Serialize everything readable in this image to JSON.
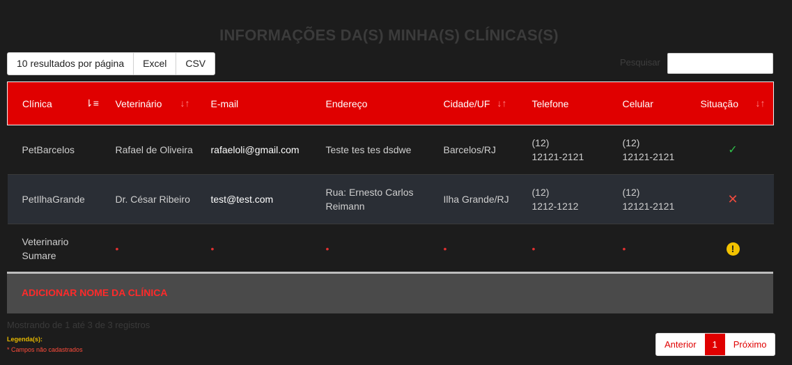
{
  "page": {
    "title": "INFORMAÇÕES DA(S) MINHA(S) CLÍNICAS(S)"
  },
  "toolbar": {
    "page_size_label": "10 resultados por página",
    "excel_label": "Excel",
    "csv_label": "CSV"
  },
  "search": {
    "label": "Pesquisar",
    "value": "",
    "placeholder": ""
  },
  "table": {
    "headers": [
      "Clínica",
      "Veterinário",
      "E-mail",
      "Endereço",
      "Cidade/UF",
      "Telefone",
      "Celular",
      "Situação"
    ],
    "rows": [
      {
        "clinica": "PetBarcelos",
        "veterinario": "Rafael de Oliveira",
        "email": "rafaeloli@gmail.com",
        "endereco": "Teste tes tes dsdwe",
        "cidade": "Barcelos/RJ",
        "telefone_ddd": "(12)",
        "telefone_num": "12121-2121",
        "celular_ddd": "(12)",
        "celular_num": "12121-2121",
        "situacao": "ativo",
        "situacao_icon": "check-icon"
      },
      {
        "clinica": "PetIlhaGrande",
        "veterinario": "Dr. César Ribeiro",
        "email": "test@test.com",
        "endereco": "Rua: Ernesto Carlos Reimann",
        "cidade": "Ilha Grande/RJ",
        "telefone_ddd": "(12)",
        "telefone_num": "1212-1212",
        "celular_ddd": "(12)",
        "celular_num": "12121-2121",
        "situacao": "inativo",
        "situacao_icon": "x-icon"
      },
      {
        "clinica": "Veterinario Sumare",
        "veterinario": "•",
        "email": "•",
        "endereco": "•",
        "cidade": "•",
        "telefone": "•",
        "celular": "•",
        "situacao": "pendente",
        "situacao_icon": "warning-icon"
      }
    ]
  },
  "add_clinic": {
    "label": "ADICIONAR NOME DA CLÍNICA"
  },
  "footer": {
    "info": "Mostrando de 1 até 3 de 3 registros",
    "legend_title": "Legenda(s):",
    "legend_item": "* Campos não cadastrados"
  },
  "pagination": {
    "previous": "Anterior",
    "current": "1",
    "next": "Próximo"
  },
  "colors": {
    "accent": "#e00000",
    "background": "#1c1c1c",
    "ok": "#2fbf4a",
    "error": "#ee4b3e",
    "warning": "#f2c200"
  }
}
